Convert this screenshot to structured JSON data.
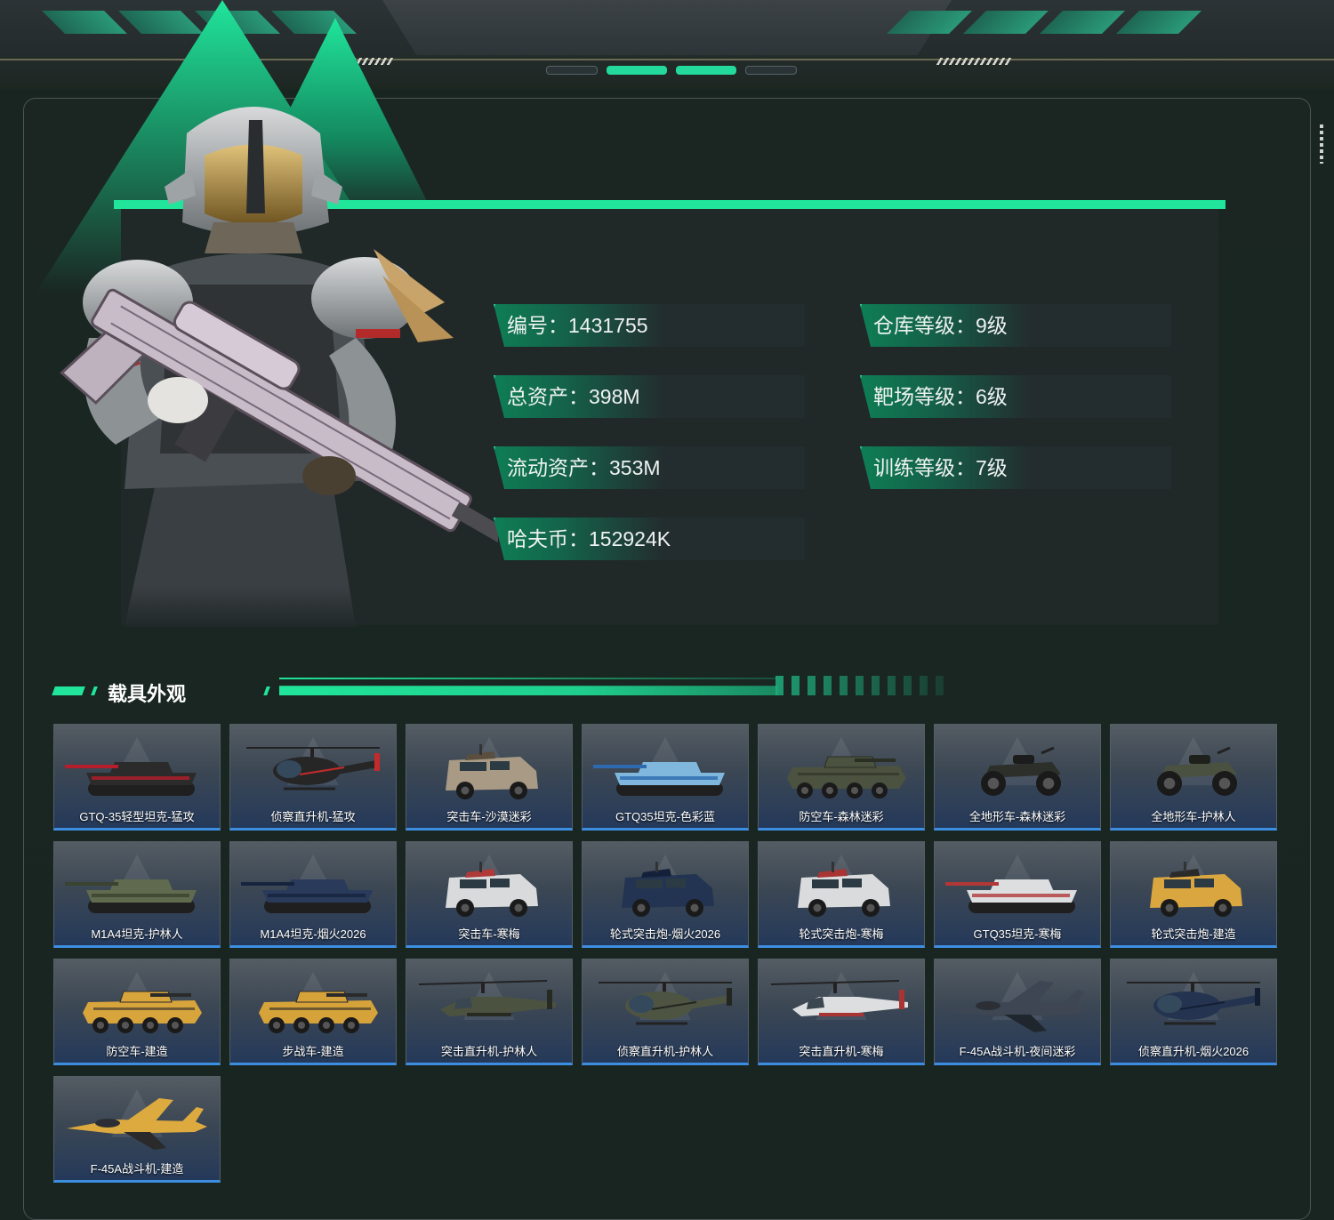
{
  "stats": {
    "id_label": "编号：1431755",
    "warehouse_label": "仓库等级：9级",
    "total_assets_label": "总资产：398M",
    "range_label": "靶场等级：6级",
    "liquid_assets_label": "流动资产：353M",
    "training_label": "训练等级：7级",
    "coins_label": "哈夫币：152924K"
  },
  "section": {
    "title": "载具外观"
  },
  "vehicles": [
    {
      "name": "GTQ-35轻型坦克-猛攻",
      "icon": "tank-icon",
      "color": "#2b2b2b",
      "accent": "#b51e2a"
    },
    {
      "name": "侦察直升机-猛攻",
      "icon": "helicopter-icon",
      "color": "#262626",
      "accent": "#c42a2a"
    },
    {
      "name": "突击车-沙漠迷彩",
      "icon": "armored-truck-icon",
      "color": "#a89a84",
      "accent": "#5a4e3e"
    },
    {
      "name": "GTQ35坦克-色彩蓝",
      "icon": "tank-icon",
      "color": "#7fb8dc",
      "accent": "#2d6ab0"
    },
    {
      "name": "防空车-森林迷彩",
      "icon": "wheeled-apc-icon",
      "color": "#4b5240",
      "accent": "#2a2f24"
    },
    {
      "name": "全地形车-森林迷彩",
      "icon": "atv-icon",
      "color": "#2c2f2a",
      "accent": "#1c1c1c"
    },
    {
      "name": "全地形车-护林人",
      "icon": "atv-icon",
      "color": "#4a5140",
      "accent": "#1e211b"
    },
    {
      "name": "M1A4坦克-护林人",
      "icon": "tank-icon",
      "color": "#5f6a4e",
      "accent": "#3a4230"
    },
    {
      "name": "M1A4坦克-烟火2026",
      "icon": "tank-icon",
      "color": "#2a3a5a",
      "accent": "#18243d"
    },
    {
      "name": "突击车-寒梅",
      "icon": "armored-truck-icon",
      "color": "#d8dadb",
      "accent": "#b03a3a"
    },
    {
      "name": "轮式突击炮-烟火2026",
      "icon": "armored-truck-icon",
      "color": "#233452",
      "accent": "#14203a"
    },
    {
      "name": "轮式突击炮-寒梅",
      "icon": "armored-truck-icon",
      "color": "#d9dbdc",
      "accent": "#a83434"
    },
    {
      "name": "GTQ35坦克-寒梅",
      "icon": "tank-icon",
      "color": "#dcdedf",
      "accent": "#b23838"
    },
    {
      "name": "轮式突击炮-建造",
      "icon": "armored-truck-icon",
      "color": "#d9a640",
      "accent": "#2a2a2a"
    },
    {
      "name": "防空车-建造",
      "icon": "wheeled-apc-icon",
      "color": "#d8a43c",
      "accent": "#2a2a2a"
    },
    {
      "name": "步战车-建造",
      "icon": "wheeled-apc-icon",
      "color": "#d6a33b",
      "accent": "#2a2a2a"
    },
    {
      "name": "突击直升机-护林人",
      "icon": "attack-helicopter-icon",
      "color": "#4c5240",
      "accent": "#262a20"
    },
    {
      "name": "侦察直升机-护林人",
      "icon": "helicopter-icon",
      "color": "#4d5442",
      "accent": "#232620"
    },
    {
      "name": "突击直升机-寒梅",
      "icon": "attack-helicopter-icon",
      "color": "#dcdedf",
      "accent": "#a83434"
    },
    {
      "name": "F-45A战斗机-夜间迷彩",
      "icon": "fighter-jet-icon",
      "color": "#3d4652",
      "accent": "#20262e"
    },
    {
      "name": "侦察直升机-烟火2026",
      "icon": "helicopter-icon",
      "color": "#243450",
      "accent": "#131e33"
    },
    {
      "name": "F-45A战斗机-建造",
      "icon": "fighter-jet-icon",
      "color": "#dcaa3e",
      "accent": "#2a2a2a"
    }
  ],
  "colors": {
    "accent": "#20e59b",
    "card_border": "#3d8ee0",
    "background": "#182520"
  }
}
